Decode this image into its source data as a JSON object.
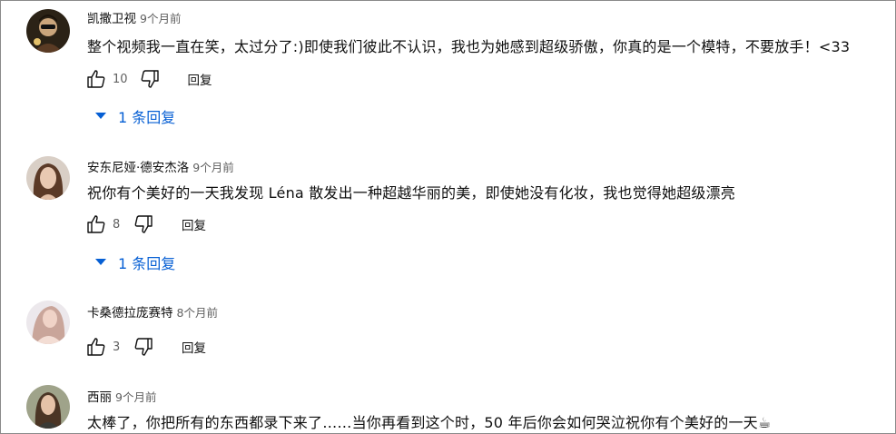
{
  "comments": [
    {
      "author": "凯撒卫视",
      "time": "9个月前",
      "text": "整个视频我一直在笑，太过分了:)即使我们彼此不认识，我也为她感到超级骄傲，你真的是一个模特，不要放手！<33",
      "likes": "10",
      "reply_label": "回复",
      "replies_label": "1 条回复"
    },
    {
      "author": "安东尼娅·德安杰洛",
      "time": "9个月前",
      "text": "祝你有个美好的一天我发现 Léna 散发出一种超越华丽的美，即使她没有化妆，我也觉得她超级漂亮",
      "likes": "8",
      "reply_label": "回复",
      "replies_label": "1 条回复"
    },
    {
      "author": "卡桑德拉庞赛特",
      "time": "8个月前",
      "likes": "3",
      "reply_label": "回复"
    },
    {
      "author": "西丽",
      "time": "9个月前",
      "text": "太棒了，你把所有的东西都录下来了……当你再看到这个时，50 年后你会如何哭泣祝你有个美好的一天☕"
    }
  ],
  "colors": {
    "link_blue": "#065fd4",
    "meta_gray": "#606060",
    "text": "#0f0f0f"
  },
  "icons": {
    "like": "thumbs-up-icon",
    "dislike": "thumbs-down-icon",
    "expand": "caret-down-icon"
  }
}
